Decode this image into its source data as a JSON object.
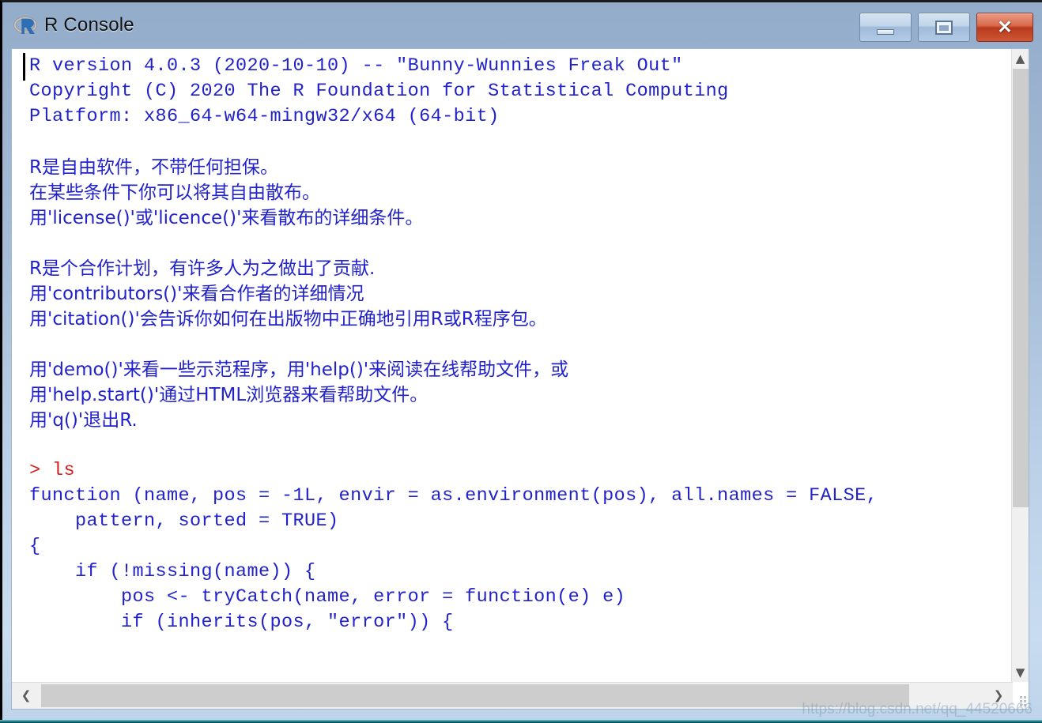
{
  "window": {
    "title": "R Console",
    "icon": "r-logo-icon",
    "colors": {
      "titlebar_top": "#93acca",
      "titlebar_bottom": "#bed4ea",
      "console_output_text": "#2222cc",
      "console_prompt_text": "#d62020",
      "console_background": "#ffffff",
      "close_button": "#b83a1d",
      "scrollbar_thumb": "#cdcdcd"
    },
    "controls": {
      "minimize_label": "—",
      "minimize_name": "minimize-button",
      "maximize_label": "",
      "maximize_name": "maximize-button",
      "close_label": "✕",
      "close_name": "close-button"
    }
  },
  "console": {
    "lines": [
      {
        "text": "R version 4.0.3 (2020-10-10) -- \"Bunny-Wunnies Freak Out\"",
        "kind": "output"
      },
      {
        "text": "Copyright (C) 2020 The R Foundation for Statistical Computing",
        "kind": "output"
      },
      {
        "text": "Platform: x86_64-w64-mingw32/x64 (64-bit)",
        "kind": "output"
      },
      {
        "text": "",
        "kind": "blank"
      },
      {
        "text": "R是自由软件，不带任何担保。",
        "kind": "cjk"
      },
      {
        "text": "在某些条件下你可以将其自由散布。",
        "kind": "cjk"
      },
      {
        "text": "用'license()'或'licence()'来看散布的详细条件。",
        "kind": "cjk"
      },
      {
        "text": "",
        "kind": "blank"
      },
      {
        "text": "R是个合作计划，有许多人为之做出了贡献.",
        "kind": "cjk"
      },
      {
        "text": "用'contributors()'来看合作者的详细情况",
        "kind": "cjk"
      },
      {
        "text": "用'citation()'会告诉你如何在出版物中正确地引用R或R程序包。",
        "kind": "cjk"
      },
      {
        "text": "",
        "kind": "blank"
      },
      {
        "text": "用'demo()'来看一些示范程序，用'help()'来阅读在线帮助文件，或",
        "kind": "cjk"
      },
      {
        "text": "用'help.start()'通过HTML浏览器来看帮助文件。",
        "kind": "cjk"
      },
      {
        "text": "用'q()'退出R.",
        "kind": "cjk"
      },
      {
        "text": "",
        "kind": "blank"
      },
      {
        "text": "> ls",
        "kind": "prompt"
      },
      {
        "text": "function (name, pos = -1L, envir = as.environment(pos), all.names = FALSE,",
        "kind": "output"
      },
      {
        "text": "    pattern, sorted = TRUE)",
        "kind": "output"
      },
      {
        "text": "{",
        "kind": "output"
      },
      {
        "text": "    if (!missing(name)) {",
        "kind": "output"
      },
      {
        "text": "        pos <- tryCatch(name, error = function(e) e)",
        "kind": "output"
      },
      {
        "text": "        if (inherits(pos, \"error\")) {",
        "kind": "output"
      }
    ]
  },
  "scrollbars": {
    "vertical": {
      "up_glyph": "⌃",
      "down_glyph": "⌄"
    },
    "horizontal": {
      "left_glyph": "❮",
      "right_glyph": "❯"
    }
  },
  "watermark": {
    "text": "https://blog.csdn.net/qq_44520666"
  }
}
